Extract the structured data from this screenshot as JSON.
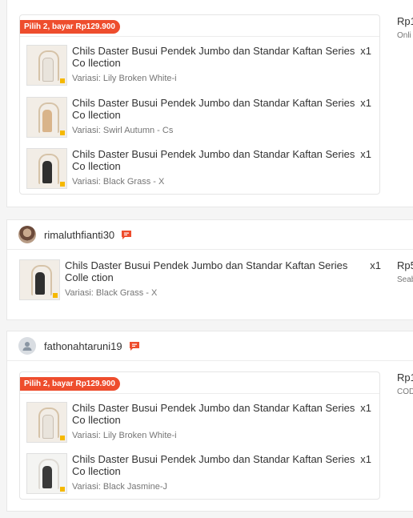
{
  "order1": {
    "promo_label": "Pilih 2, bayar Rp129.900",
    "price": "Rp1",
    "payment": "Onli",
    "items": [
      {
        "title": "Chils Daster Busui Pendek Jumbo dan Standar Kaftan Series Co llection",
        "qty": "x1",
        "variant": "Variasi: Lily Broken White-i"
      },
      {
        "title": "Chils Daster Busui Pendek Jumbo dan Standar Kaftan Series Co llection",
        "qty": "x1",
        "variant": "Variasi: Swirl Autumn - Cs"
      },
      {
        "title": "Chils Daster Busui Pendek Jumbo dan Standar Kaftan Series Co llection",
        "qty": "x1",
        "variant": "Variasi: Black Grass - X"
      }
    ]
  },
  "order2": {
    "username": "rimaluthfianti30",
    "price": "Rp5",
    "payment": "Seab",
    "items": [
      {
        "title": "Chils Daster Busui Pendek Jumbo dan Standar Kaftan Series Colle ction",
        "qty": "x1",
        "variant": "Variasi: Black Grass - X"
      }
    ]
  },
  "order3": {
    "username": "fathonahtaruni19",
    "promo_label": "Pilih 2, bayar Rp129.900",
    "price": "Rp1",
    "payment": "COD",
    "items": [
      {
        "title": "Chils Daster Busui Pendek Jumbo dan Standar Kaftan Series Co llection",
        "qty": "x1",
        "variant": "Variasi: Lily Broken White-i"
      },
      {
        "title": "Chils Daster Busui Pendek Jumbo dan Standar Kaftan Series Co llection",
        "qty": "x1",
        "variant": "Variasi: Black Jasmine-J"
      }
    ]
  },
  "icons": {
    "chat": "chat-icon",
    "avatar_default": "user-icon"
  },
  "colors": {
    "accent": "#ee4d2d",
    "price_text": "#333333",
    "muted": "#757575"
  }
}
